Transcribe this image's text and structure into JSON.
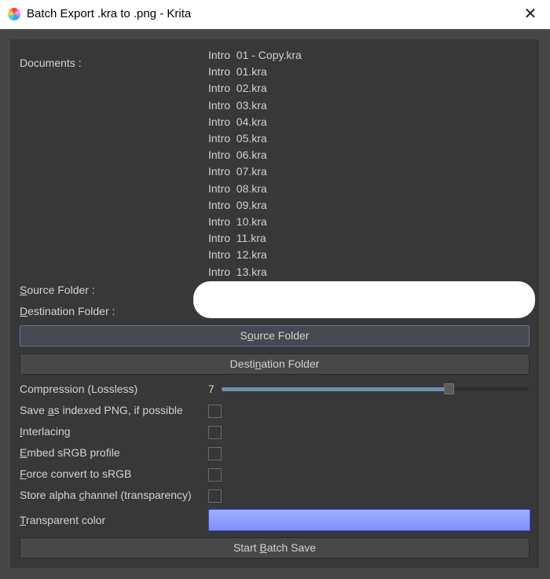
{
  "window": {
    "title": "Batch Export .kra to .png - Krita",
    "close": "✕"
  },
  "documents_label": "Documents :",
  "documents": [
    "Intro  01 - Copy.kra",
    "Intro  01.kra",
    "Intro  02.kra",
    "Intro  03.kra",
    "Intro  04.kra",
    "Intro  05.kra",
    "Intro  06.kra",
    "Intro  07.kra",
    "Intro  08.kra",
    "Intro  09.kra",
    "Intro  10.kra",
    "Intro  11.kra",
    "Intro  12.kra",
    "Intro  13.kra"
  ],
  "source_label": {
    "pre": "",
    "key": "S",
    "post": "ource Folder :"
  },
  "dest_label": {
    "pre": "",
    "key": "D",
    "post": "estination Folder :"
  },
  "source_button": {
    "pre": "S",
    "key": "o",
    "post": "urce Folder"
  },
  "dest_button": {
    "pre": "Desti",
    "key": "n",
    "post": "ation Folder"
  },
  "compression": {
    "label": "Compression (Lossless)",
    "value": "7",
    "min": 0,
    "max": 9
  },
  "options": [
    {
      "pre": "Save ",
      "key": "a",
      "post": "s indexed PNG, if possible",
      "checked": false
    },
    {
      "pre": "",
      "key": "I",
      "post": "nterlacing",
      "checked": false
    },
    {
      "pre": "",
      "key": "E",
      "post": "mbed sRGB profile",
      "checked": false
    },
    {
      "pre": "",
      "key": "F",
      "post": "orce convert to sRGB",
      "checked": false
    },
    {
      "pre": "Store alpha ",
      "key": "c",
      "post": "hannel (transparency)",
      "checked": false
    }
  ],
  "transparent_color": {
    "pre": "",
    "key": "T",
    "post": "ransparent color",
    "color": "#7f90ff"
  },
  "start_button": {
    "pre": "Start ",
    "key": "B",
    "post": "atch Save"
  }
}
